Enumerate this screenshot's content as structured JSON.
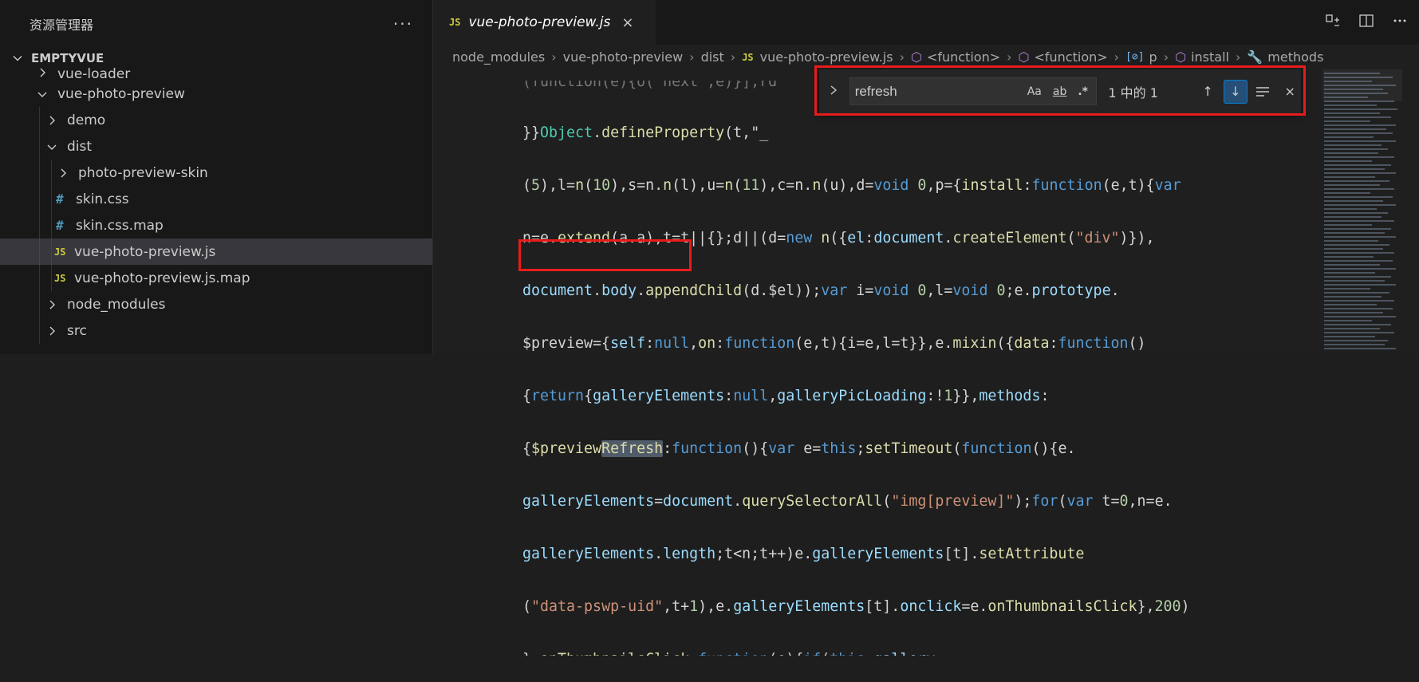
{
  "sidebar": {
    "title": "资源管理器",
    "more_actions": "···",
    "project": "EMPTYVUE",
    "items": [
      {
        "label": "vue-loader",
        "icon": "chevron-right-icon",
        "kind": "folder"
      },
      {
        "label": "vue-photo-preview",
        "icon": "chevron-down-icon",
        "kind": "folder"
      },
      {
        "label": "demo",
        "icon": "chevron-right-icon",
        "kind": "folder"
      },
      {
        "label": "dist",
        "icon": "chevron-down-icon",
        "kind": "folder"
      },
      {
        "label": "photo-preview-skin",
        "icon": "chevron-right-icon",
        "kind": "folder"
      },
      {
        "label": "skin.css",
        "icon": "#",
        "kind": "css"
      },
      {
        "label": "skin.css.map",
        "icon": "#",
        "kind": "css"
      },
      {
        "label": "vue-photo-preview.js",
        "icon": "JS",
        "kind": "js",
        "selected": true
      },
      {
        "label": "vue-photo-preview.js.map",
        "icon": "JS",
        "kind": "js"
      },
      {
        "label": "node_modules",
        "icon": "chevron-right-icon",
        "kind": "folder"
      },
      {
        "label": "src",
        "icon": "chevron-right-icon",
        "kind": "folder"
      }
    ]
  },
  "tab": {
    "icon": "JS",
    "title": "vue-photo-preview.js",
    "close": "×"
  },
  "breadcrumb": {
    "items": [
      "node_modules",
      "vue-photo-preview",
      "dist",
      "vue-photo-preview.js",
      "<function>",
      "<function>",
      "p",
      "install",
      "methods"
    ],
    "js_icon": "JS"
  },
  "find": {
    "query": "refresh",
    "match_case": "Aa",
    "whole_word": "ab",
    "regex": ".*",
    "count": "1 中的 1",
    "prev": "↑",
    "next": "↓",
    "close": "×"
  },
  "colors": {
    "annotation": "#e81b1b",
    "accent": "#007fd4",
    "js": "#cbcb41",
    "css": "#519aba"
  }
}
